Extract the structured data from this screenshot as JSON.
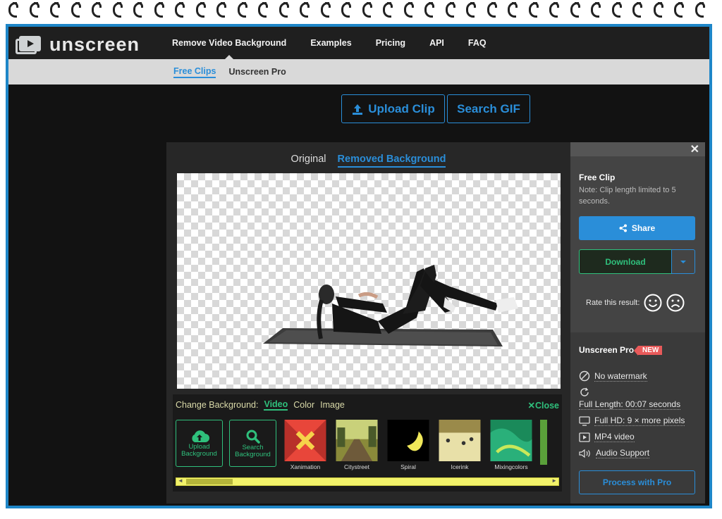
{
  "brand": {
    "name": "unscreen"
  },
  "nav": {
    "items": [
      "Remove Video Background",
      "Examples",
      "Pricing",
      "API",
      "FAQ"
    ]
  },
  "subnav": {
    "free_clips": "Free Clips",
    "unscreen_pro": "Unscreen Pro"
  },
  "actions": {
    "upload_clip": "Upload Clip",
    "search_gif": "Search GIF"
  },
  "preview_tabs": {
    "original": "Original",
    "removed": "Removed Background"
  },
  "change_bg": {
    "label": "Change Background:",
    "options": [
      "Video",
      "Color",
      "Image"
    ],
    "close": "Close",
    "upload_line1": "Upload",
    "upload_line2": "Background",
    "search_line1": "Search",
    "search_line2": "Background",
    "thumbs": [
      "Xanimation",
      "Citystreet",
      "Spiral",
      "Icerink",
      "Mixingcolors"
    ]
  },
  "side": {
    "close": "✕",
    "free_title": "Free Clip",
    "free_note": "Note: Clip length limited to 5 seconds.",
    "share": "Share",
    "download": "Download",
    "rate": "Rate this result:",
    "pro_title": "Unscreen Pro",
    "new_badge": "NEW",
    "features": [
      "No watermark",
      "Full Length: 00:07 seconds",
      "Full HD: 9 × more pixels",
      "MP4 video",
      "Audio Support"
    ],
    "process_pro": "Process with Pro"
  },
  "colors": {
    "accent": "#2a8ed9",
    "green": "#2fc07c",
    "border": "#1e86c8",
    "new": "#e85a5a"
  }
}
